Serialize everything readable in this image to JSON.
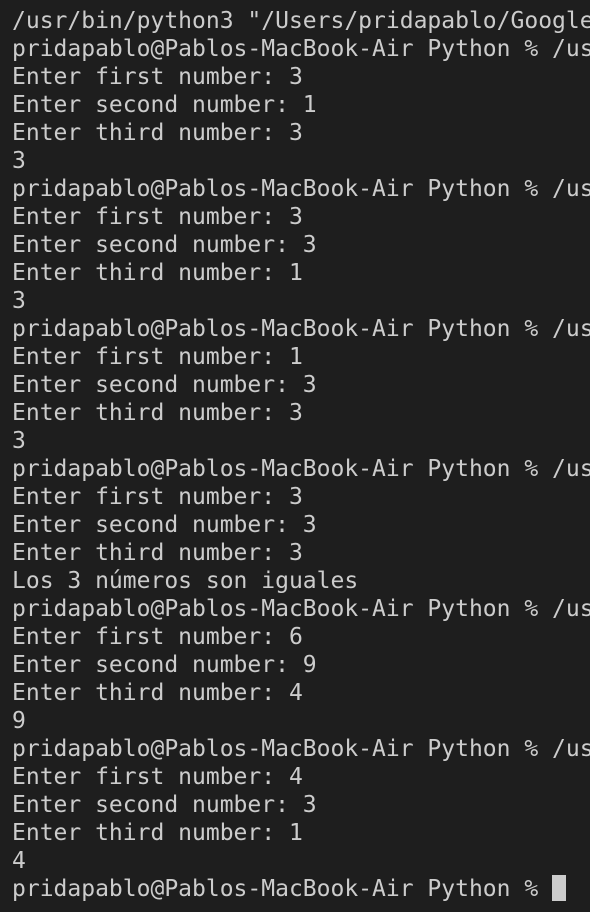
{
  "terminal": {
    "lines": [
      "/usr/bin/python3 \"/Users/pridapablo/Google",
      "pridapablo@Pablos-MacBook-Air Python % /us",
      "Enter first number: 3",
      "Enter second number: 1",
      "Enter third number: 3",
      "3",
      "pridapablo@Pablos-MacBook-Air Python % /us",
      "Enter first number: 3",
      "Enter second number: 3",
      "Enter third number: 1",
      "3",
      "pridapablo@Pablos-MacBook-Air Python % /us",
      "Enter first number: 1",
      "Enter second number: 3",
      "Enter third number: 3",
      "3",
      "pridapablo@Pablos-MacBook-Air Python % /us",
      "Enter first number: 3",
      "Enter second number: 3",
      "Enter third number: 3",
      "Los 3 números son iguales",
      "pridapablo@Pablos-MacBook-Air Python % /us",
      "Enter first number: 6",
      "Enter second number: 9",
      "Enter third number: 4",
      "9",
      "pridapablo@Pablos-MacBook-Air Python % /us",
      "Enter first number: 4",
      "Enter second number: 3",
      "Enter third number: 1",
      "4"
    ],
    "prompt": "pridapablo@Pablos-MacBook-Air Python % ",
    "colors": {
      "background": "#1e1e1e",
      "text": "#cccccc",
      "cursor": "#cccccc"
    }
  }
}
